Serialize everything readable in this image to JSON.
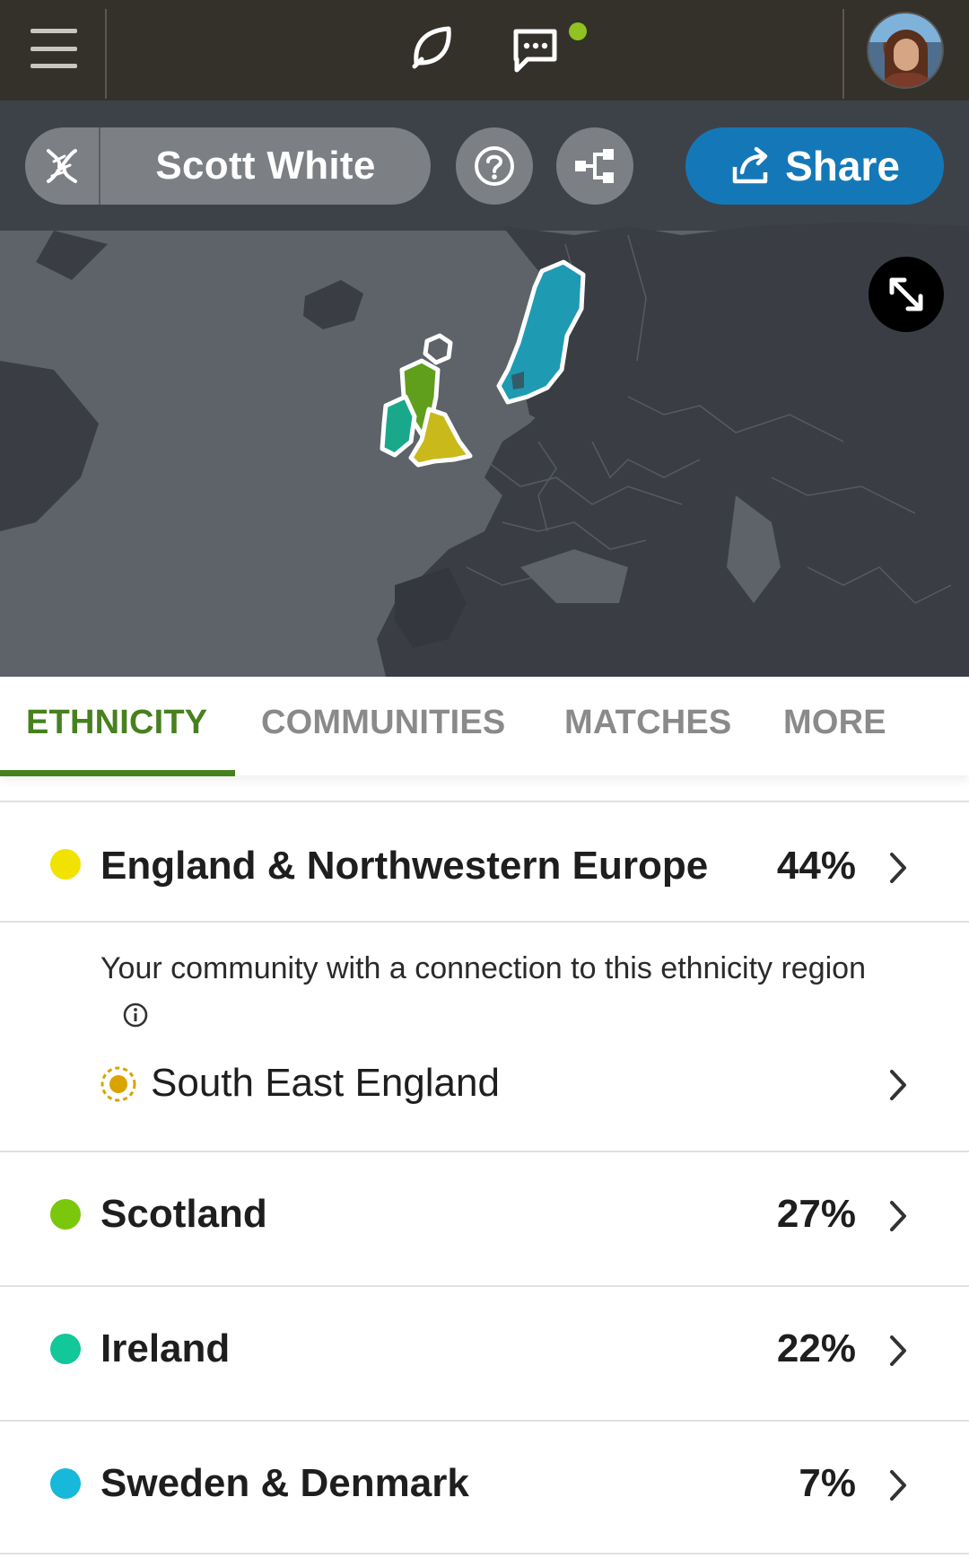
{
  "topbar": {
    "menu_icon": "hamburger-menu-icon",
    "logo_icon": "ancestry-leaf-icon",
    "messages_icon": "chat-bubble-icon",
    "notification_color": "#8fc31f"
  },
  "profile": {
    "name": "Scott White",
    "dna_icon": "dna-icon",
    "help_icon": "question-icon",
    "tree_icon": "family-tree-icon",
    "share_label": "Share"
  },
  "map": {
    "expand_icon": "expand-arrows-icon",
    "colors": {
      "england": "#c9b91a",
      "scotland": "#5f9f1c",
      "ireland": "#1aa88a",
      "sweden": "#1f9ab3"
    }
  },
  "tabs": [
    {
      "label": "ETHNICITY",
      "active": true
    },
    {
      "label": "COMMUNITIES",
      "active": false
    },
    {
      "label": "MATCHES",
      "active": false
    },
    {
      "label": "MORE",
      "active": false
    }
  ],
  "ethnicity": [
    {
      "region": "England & Northwestern Europe",
      "percent": "44%",
      "color": "#f2e200"
    },
    {
      "region": "Scotland",
      "percent": "27%",
      "color": "#7ac70c"
    },
    {
      "region": "Ireland",
      "percent": "22%",
      "color": "#12c79a"
    },
    {
      "region": "Sweden & Denmark",
      "percent": "7%",
      "color": "#18b8db"
    }
  ],
  "community": {
    "intro": "Your community with a connection to this ethnicity region",
    "info_icon": "info-icon",
    "name": "South East England",
    "icon": "community-sun-icon",
    "color": "#d9a300"
  }
}
